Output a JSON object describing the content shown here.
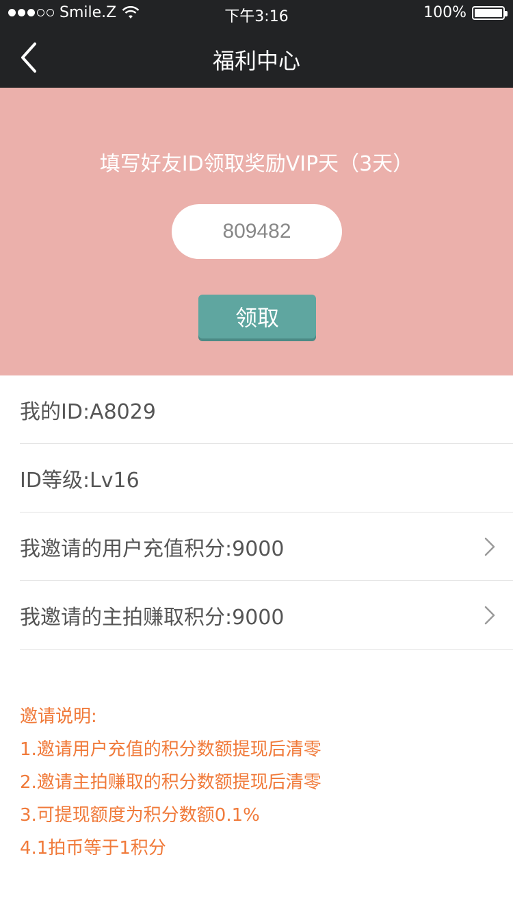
{
  "status_bar": {
    "carrier": "Smile.Z",
    "time": "下午3:16",
    "battery": "100%"
  },
  "nav": {
    "title": "福利中心"
  },
  "hero": {
    "title": "填写好友ID领取奖励VIP天（3天）",
    "input_value": "809482",
    "claim_label": "领取"
  },
  "info": {
    "rows": [
      {
        "label": "我的ID:A8029"
      },
      {
        "label": "ID等级:Lv16"
      },
      {
        "label": "我邀请的用户充值积分:9000"
      },
      {
        "label": "我邀请的主拍赚取积分:9000"
      }
    ]
  },
  "notes": {
    "title": "邀请说明:",
    "items": [
      "1.邀请用户充值的积分数额提现后清零",
      "2.邀请主拍赚取的积分数额提现后清零",
      "3.可提现额度为积分数额0.1%",
      "4.1拍币等于1积分"
    ]
  },
  "colors": {
    "nav_bg": "#222325",
    "hero_bg": "#ebb0ab",
    "button_bg": "#5fa6a0",
    "note_text": "#f07a3a"
  }
}
